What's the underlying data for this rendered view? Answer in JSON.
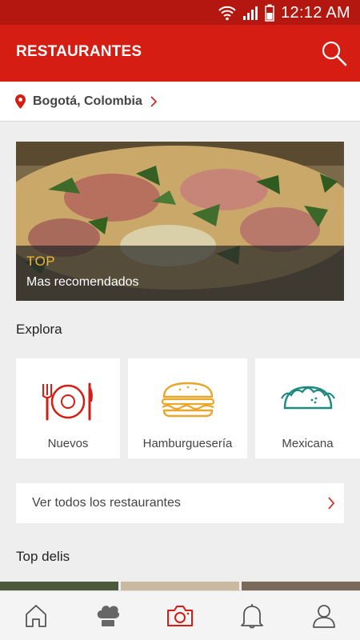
{
  "status_bar": {
    "time": "12:12 AM",
    "icons": [
      "wifi-icon",
      "signal-icon",
      "battery-icon"
    ]
  },
  "app_bar": {
    "title": "RESTAURANTES",
    "search_icon": "search-icon"
  },
  "location": {
    "icon": "location-pin-icon",
    "text": "Bogotá, Colombia"
  },
  "hero": {
    "tag": "TOP",
    "subtitle": "Mas recomendados"
  },
  "explore": {
    "title": "Explora",
    "categories": [
      {
        "label": "Nuevos",
        "icon": "plate-cutlery-icon"
      },
      {
        "label": "Hamburguesería",
        "icon": "burger-icon"
      },
      {
        "label": "Mexicana",
        "icon": "taco-icon"
      }
    ]
  },
  "view_all": {
    "label": "Ver todos los restaurantes"
  },
  "top_delis": {
    "title": "Top delis"
  },
  "bottom_nav": {
    "items": [
      {
        "icon": "home-icon"
      },
      {
        "icon": "chef-hat-icon"
      },
      {
        "icon": "camera-icon"
      },
      {
        "icon": "bell-icon"
      },
      {
        "icon": "profile-icon"
      }
    ]
  },
  "colors": {
    "brand_red": "#d61d13",
    "status_red": "#b3170f",
    "accent_yellow": "#f0b534",
    "icon_orange": "#e8a62a",
    "icon_teal": "#1e8a7e"
  }
}
